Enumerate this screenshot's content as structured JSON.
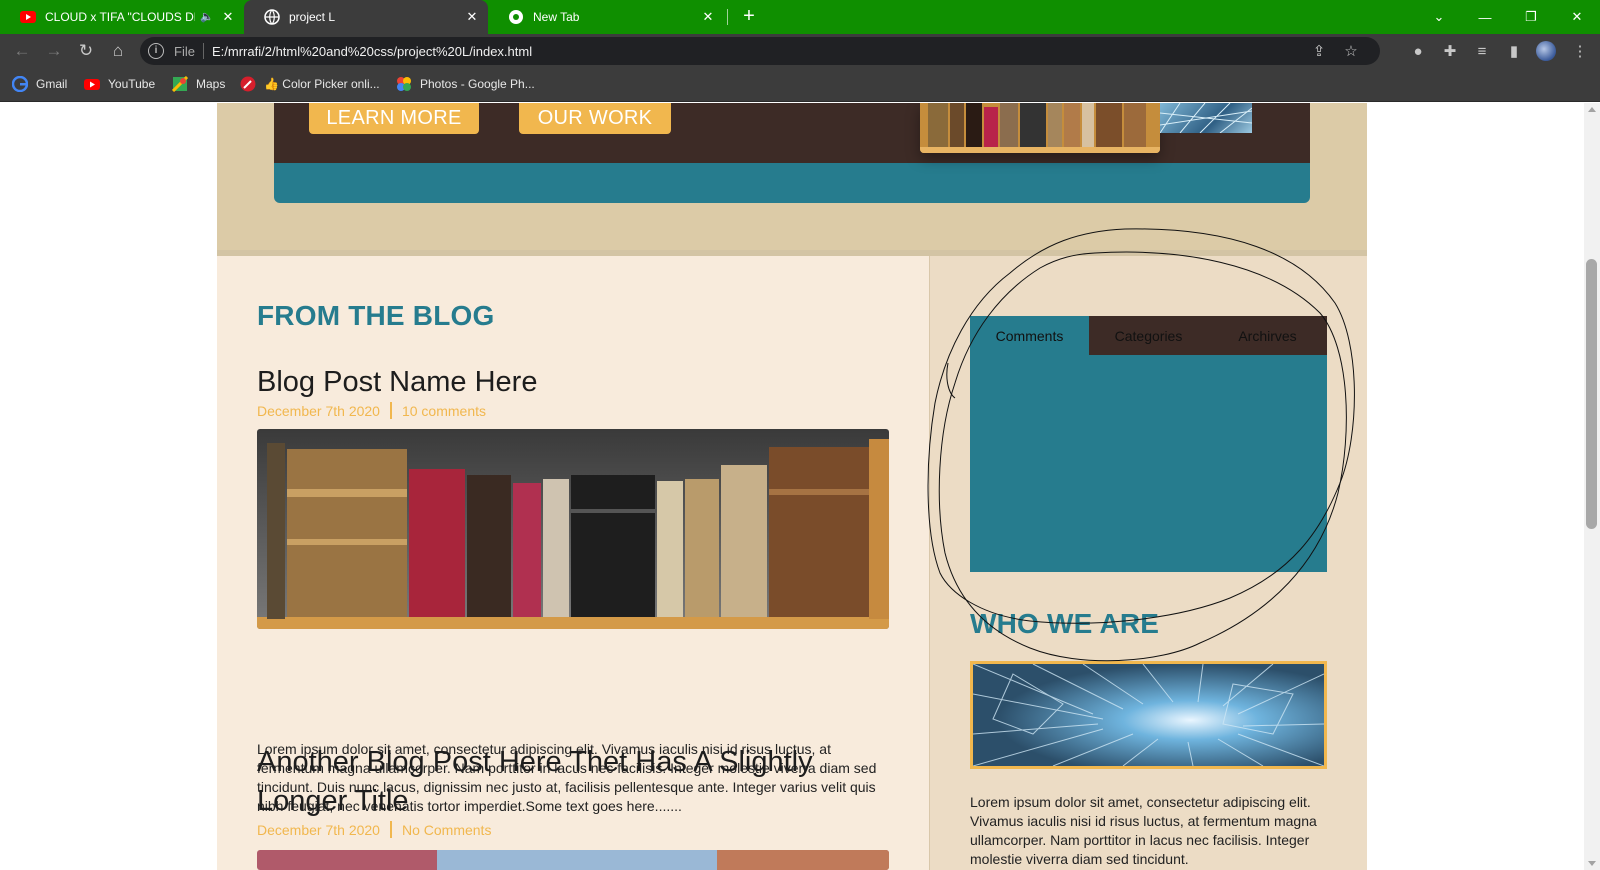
{
  "browser": {
    "tabs": [
      {
        "title": "CLOUD x TIFA \"CLOUDS DRE",
        "active": false,
        "close": "✕"
      },
      {
        "title": "project L",
        "active": true,
        "close": "✕"
      },
      {
        "title": "New Tab",
        "active": false,
        "close": "✕"
      }
    ],
    "new_tab_label": "+",
    "window_controls": {
      "tab_search": "⌄",
      "minimize": "—",
      "restore": "❐",
      "close": "✕"
    },
    "address": {
      "scheme_label": "File",
      "url": "E:/mrrafi/2/html%20and%20css/project%20L/index.html"
    },
    "bookmarks": [
      {
        "label": "Gmail",
        "icon": "google-icon"
      },
      {
        "label": "YouTube",
        "icon": "youtube-icon"
      },
      {
        "label": "Maps",
        "icon": "maps-icon"
      },
      {
        "label": "👍 Color Picker onli...",
        "icon": "color-picker-icon"
      },
      {
        "label": "Photos - Google Ph...",
        "icon": "photos-icon"
      }
    ]
  },
  "hero": {
    "learn_more": "LEARN MORE",
    "our_work": "OUR WORK"
  },
  "blog": {
    "heading": "FROM THE BLOG",
    "posts": [
      {
        "title": "Blog Post Name Here",
        "date": "December 7th 2020",
        "comments": "10 comments",
        "image": "bookshelf-image",
        "excerpt": "Lorem ipsum dolor sit amet, consectetur adipiscing elit. Vivamus iaculis nisi id risus luctus, at fermentum magna ullamcorper. Nam porttitor in lacus nec facilisis. Integer molestie viverra diam sed tincidunt. Duis nunc lacus, dignissim nec justo at, facilisis pellentesque ante. Integer varius velit quis nibh feugiat, nec venenatis tortor imperdiet.Some text goes here......."
      },
      {
        "title": "Another Blog Post Here Thet Has A Slightly Longer Title",
        "date": "December 7th 2020",
        "comments": "No Comments",
        "image": "landscape-image"
      }
    ]
  },
  "sidebar": {
    "tabs": [
      {
        "label": "Comments",
        "active": true
      },
      {
        "label": "Categories",
        "active": false
      },
      {
        "label": "Archirves",
        "active": false
      }
    ],
    "who_heading": "WHO WE ARE",
    "who_image": "tunnel-image",
    "who_text": "Lorem ipsum dolor sit amet, consectetur adipiscing elit. Vivamus iaculis nisi id risus luctus, at fermentum magna ullamcorper. Nam porttitor in lacus nec facilisis. Integer molestie viverra diam sed tincidunt."
  },
  "colors": {
    "chrome_tabbar": "#0f8f00",
    "chrome_toolbar": "#3c3c3c",
    "teal": "#267c8e",
    "dark_brown": "#3d2b26",
    "orange": "#f1b74e",
    "beige_light": "#f8ebdc",
    "beige_sidebar": "#ecdcc5",
    "beige_hero": "#dccba7"
  }
}
